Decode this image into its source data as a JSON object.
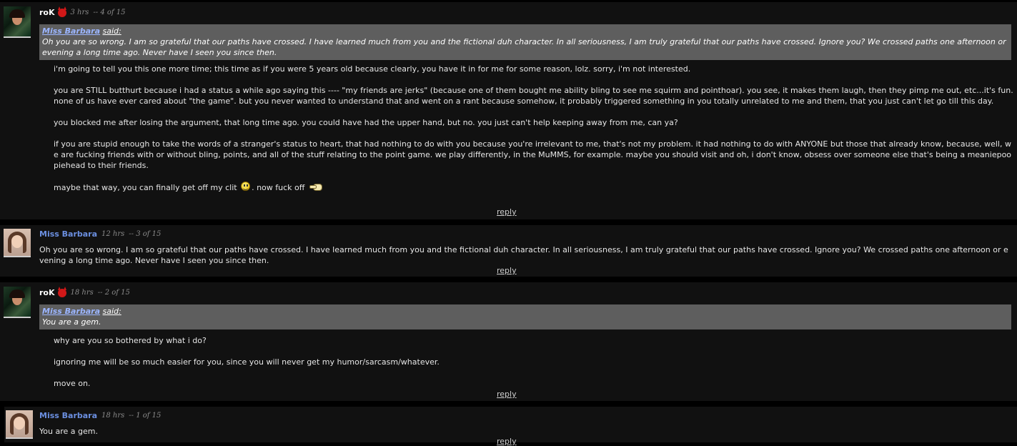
{
  "comments": [
    {
      "author": "roK",
      "time": "3 hrs",
      "position": "-- 4 of 15",
      "quote": {
        "author": "Miss Barbara",
        "said": "said:",
        "text": "Oh you are so wrong. I am so grateful that our paths have crossed. I have learned much from you and the fictional duh character. In all seriousness, I am truly grateful that our paths have crossed. Ignore you? We crossed paths one afternoon or evening a long time ago. Never have I seen you since then."
      },
      "paragraphs": [
        "i'm going to tell you this one more time; this time as if you were 5 years old because clearly, you have it in for me for some reason, lolz. sorry, i'm not interested.",
        "you are STILL butthurt because i had a status a while ago saying this ---- \"my friends are jerks\" (because one of them bought me ability bling to see me squirm and pointhoar). you see, it makes them laugh, then they pimp me out, etc...it's fun. none of us have ever cared about \"the game\". but you never wanted to understand that and went on a rant because somehow, it probably triggered something in you totally unrelated to me and them, that you just can't let go till this day.",
        "you blocked me after losing the argument, that long time ago. you could have had the upper hand, but no. you just can't help keeping away from me, can ya?",
        "if you are stupid enough to take the words of a stranger's status to heart, that had nothing to do with you because you're irrelevant to me, that's not my problem. it had nothing to do with ANYONE but those that already know, because, well, we are fucking friends with or without bling, points, and all of the stuff relating to the point game. we play differently, in the MuMMS, for example. maybe you should visit and oh, i don't know, obsess over someone else that's being a meaniepoopiehead to their friends."
      ],
      "last_a": "maybe that way, you can finally get off my clit",
      "last_b": ". now fuck off",
      "reply": "reply"
    },
    {
      "author": "Miss Barbara",
      "time": "12 hrs",
      "position": "-- 3 of 15",
      "paragraphs": [
        "Oh you are so wrong. I am so grateful that our paths have crossed. I have learned much from you and the fictional duh character. In all seriousness, I am truly grateful that our paths have crossed. Ignore you? We crossed paths one afternoon or evening a long time ago. Never have I seen you since then."
      ],
      "reply": "reply"
    },
    {
      "author": "roK",
      "time": "18 hrs",
      "position": "-- 2 of 15",
      "quote": {
        "author": "Miss Barbara",
        "said": "said:",
        "text": "You are a gem."
      },
      "paragraphs": [
        "why are you so bothered by what i do?",
        "ignoring me will be so much easier for you, since you will never get my humor/sarcasm/whatever.",
        "move on."
      ],
      "reply": "reply"
    },
    {
      "author": "Miss Barbara",
      "time": "18 hrs",
      "position": "-- 1 of 15",
      "paragraphs": [
        "You are a gem."
      ],
      "reply": "reply"
    }
  ],
  "colors": {
    "page_bg": "#000000",
    "comment_bg": "#111111",
    "quote_bg": "#5e5e5e",
    "author_link": "#6b8fe0"
  },
  "icons": [
    "devil-icon",
    "smiley-icon",
    "point-icon"
  ]
}
